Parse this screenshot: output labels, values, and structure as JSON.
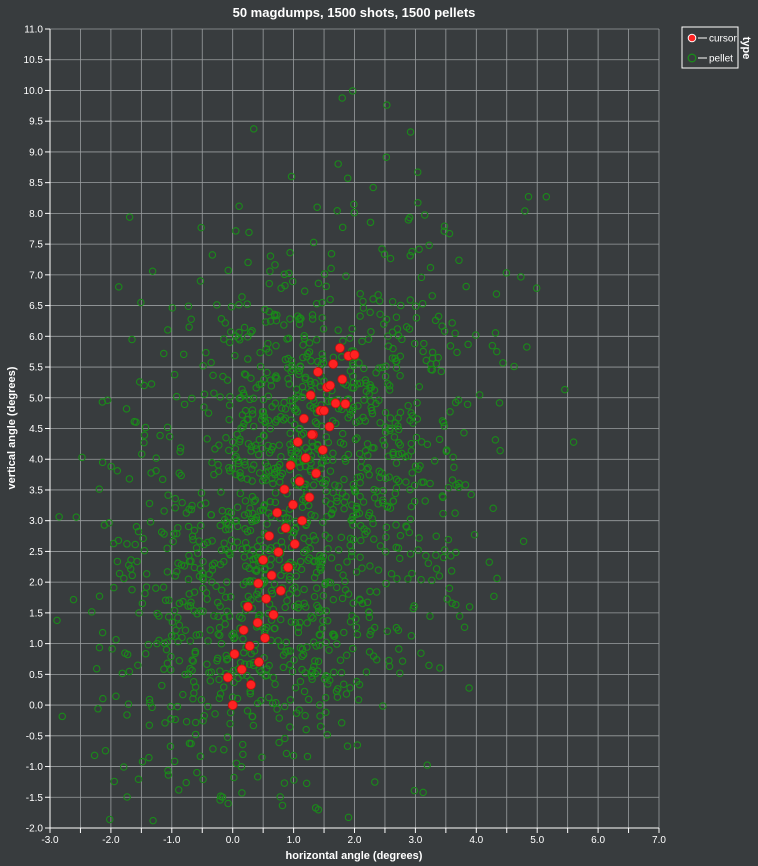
{
  "chart_data": {
    "type": "scatter",
    "title": "50 magdumps, 1500 shots, 1500 pellets",
    "xlabel": "horizontal angle (degrees)",
    "ylabel": "vertical angle (degrees)",
    "xlim": [
      -3.0,
      7.0
    ],
    "ylim": [
      -2.0,
      11.0
    ],
    "x_ticks": [
      -3.0,
      -2.0,
      -1.0,
      0.0,
      1.0,
      2.0,
      3.0,
      4.0,
      5.0,
      6.0,
      7.0
    ],
    "y_ticks": [
      -2.0,
      -1.5,
      -1.0,
      -0.5,
      0.0,
      0.5,
      1.0,
      1.5,
      2.0,
      2.5,
      3.0,
      3.5,
      4.0,
      4.5,
      5.0,
      5.5,
      6.0,
      6.5,
      7.0,
      7.5,
      8.0,
      8.5,
      9.0,
      9.5,
      10.0,
      10.5,
      11.0
    ],
    "grid": true,
    "legend": {
      "title": "type",
      "placement": "top-right"
    },
    "series": [
      {
        "name": "cursor",
        "color": "#ff2222",
        "x": [
          0.0,
          -0.08,
          0.15,
          0.03,
          0.3,
          0.43,
          0.28,
          0.53,
          0.18,
          0.41,
          0.67,
          0.25,
          0.55,
          0.79,
          0.42,
          0.64,
          0.91,
          0.5,
          0.75,
          1.02,
          0.6,
          0.87,
          1.14,
          0.73,
          0.99,
          1.26,
          0.85,
          1.1,
          1.37,
          0.95,
          1.2,
          1.48,
          1.07,
          1.32,
          1.59,
          1.17,
          1.44,
          1.69,
          1.28,
          1.55,
          1.8,
          1.4,
          1.65,
          1.9,
          1.5,
          1.76,
          2.0,
          1.6,
          1.3,
          1.85
        ],
        "y": [
          0.0,
          0.45,
          0.58,
          0.83,
          0.33,
          0.7,
          0.96,
          1.09,
          1.22,
          1.34,
          1.47,
          1.6,
          1.73,
          1.86,
          1.98,
          2.11,
          2.24,
          2.36,
          2.49,
          2.62,
          2.75,
          2.88,
          3.0,
          3.13,
          3.26,
          3.38,
          3.51,
          3.64,
          3.77,
          3.9,
          4.02,
          4.15,
          4.28,
          4.4,
          4.53,
          4.66,
          4.79,
          4.91,
          5.04,
          5.17,
          5.3,
          5.42,
          5.55,
          5.68,
          4.79,
          5.81,
          5.7,
          5.2,
          4.4,
          4.9
        ]
      },
      {
        "name": "pellet",
        "color": "#1a8a1a",
        "points": "generated"
      }
    ]
  }
}
